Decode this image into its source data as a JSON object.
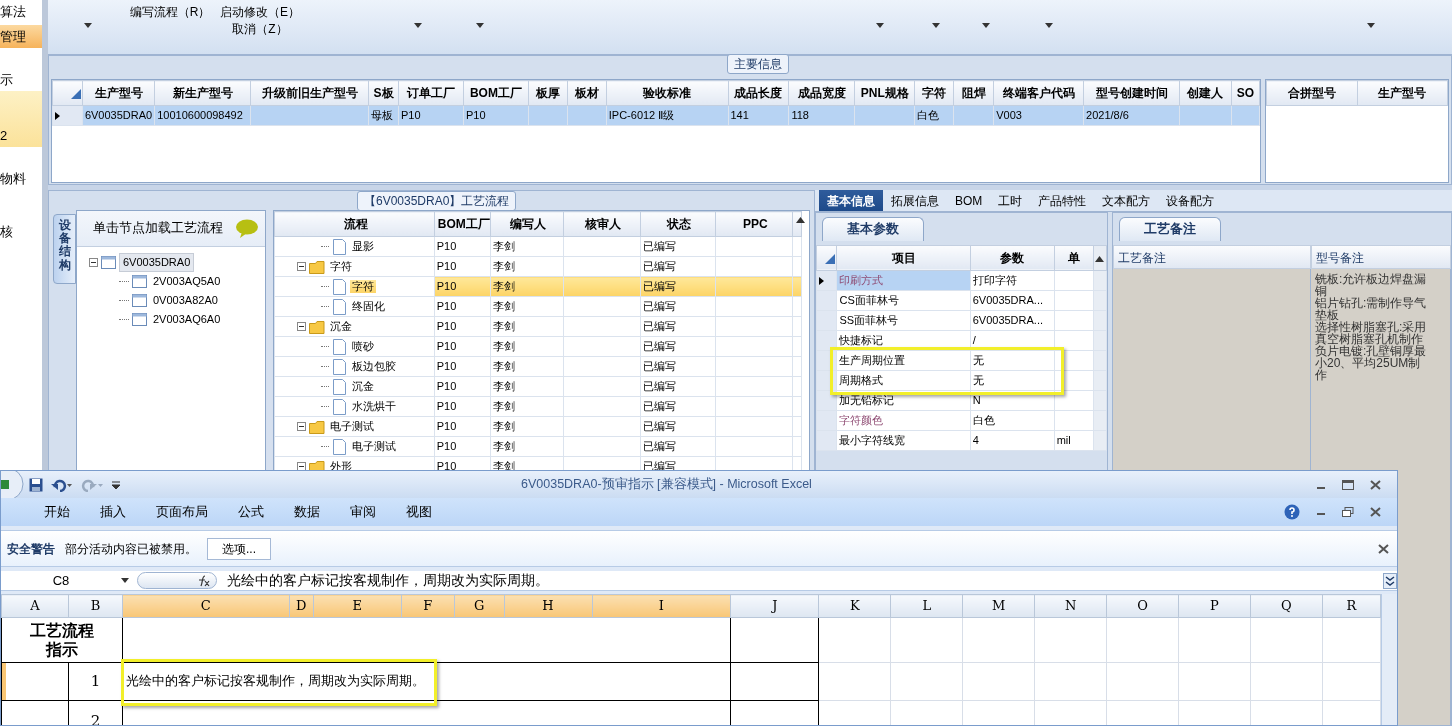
{
  "sidebar": {
    "items": [
      {
        "label": "算法",
        "selected": false,
        "hovered": false
      },
      {
        "label": "管理",
        "selected": true,
        "hovered": false
      },
      {
        "label": "示",
        "selected": false,
        "hovered": false
      },
      {
        "label": "2",
        "selected": false,
        "hovered": true
      },
      {
        "label": "物料",
        "selected": false,
        "hovered": false
      },
      {
        "label": "核",
        "selected": false,
        "hovered": false
      }
    ]
  },
  "toolbar": {
    "groups": [
      {
        "dropdown": true
      },
      {
        "labels": [
          "编写流程（R）"
        ],
        "dropdown": false
      },
      {
        "labels": [
          "启动修改（E）",
          "取消（Z）"
        ],
        "dropdown": false
      },
      {
        "dropdown": true
      },
      {
        "dropdown": true
      },
      {
        "dropdown": true
      },
      {
        "dropdown": true
      },
      {
        "dropdown": true
      },
      {
        "dropdown": true
      },
      {
        "dropdown": true
      }
    ]
  },
  "main_info": {
    "title": "主要信息",
    "columns": [
      "生产型号",
      "新生产型号",
      "升级前旧生产型号",
      "S板",
      "订单工厂",
      "BOM工厂",
      "板厚",
      "板材",
      "验收标准",
      "成品长度",
      "成品宽度",
      "PNL规格",
      "字符",
      "阻焊",
      "终端客户代码",
      "型号创建时间",
      "创建人",
      "SO"
    ],
    "rows": [
      {
        "selected": true,
        "cells": [
          "6V0035DRA0",
          "10010600098492",
          null,
          "母板",
          "P10",
          "P10",
          null,
          null,
          "IPC-6012 Ⅱ级",
          "141",
          "118",
          null,
          "白色",
          null,
          "V003",
          "2021/8/6",
          null,
          null
        ]
      }
    ],
    "side_columns": [
      "合拼型号",
      "生产型号"
    ]
  },
  "process": {
    "title": "【6V0035DRA0】工艺流程",
    "side_tab": "设备结构",
    "tree_hint": "单击节点加载工艺流程",
    "tree": [
      {
        "label": "6V0035DRA0",
        "selected": true,
        "expanded": true,
        "children": [
          {
            "label": "2V003AQ5A0",
            "selected": false
          },
          {
            "label": "0V003A82A0",
            "selected": false
          },
          {
            "label": "2V003AQ6A0",
            "selected": false
          }
        ]
      }
    ],
    "columns": [
      "流程",
      "BOM工厂",
      "编写人",
      "核审人",
      "状态",
      "PPC"
    ],
    "steps": [
      {
        "kind": "step",
        "label": "显影",
        "bom": "P10",
        "writer": "李剑",
        "status": "已编写",
        "selected": false
      },
      {
        "kind": "folder",
        "label": "字符",
        "bom": "P10",
        "writer": "李剑",
        "status": "已编写",
        "selected": false,
        "expanded": true,
        "children": [
          {
            "kind": "step",
            "label": "字符",
            "bom": "P10",
            "writer": "李剑",
            "status": "已编写",
            "selected": true
          },
          {
            "kind": "step",
            "label": "终固化",
            "bom": "P10",
            "writer": "李剑",
            "status": "已编写",
            "selected": false
          }
        ]
      },
      {
        "kind": "folder",
        "label": "沉金",
        "bom": "P10",
        "writer": "李剑",
        "status": "已编写",
        "selected": false,
        "expanded": true,
        "children": [
          {
            "kind": "step",
            "label": "喷砂",
            "bom": "P10",
            "writer": "李剑",
            "status": "已编写",
            "selected": false
          },
          {
            "kind": "step",
            "label": "板边包胶",
            "bom": "P10",
            "writer": "李剑",
            "status": "已编写",
            "selected": false
          },
          {
            "kind": "step",
            "label": "沉金",
            "bom": "P10",
            "writer": "李剑",
            "status": "已编写",
            "selected": false
          },
          {
            "kind": "step",
            "label": "水洗烘干",
            "bom": "P10",
            "writer": "李剑",
            "status": "已编写",
            "selected": false
          }
        ]
      },
      {
        "kind": "folder",
        "label": "电子测试",
        "bom": "P10",
        "writer": "李剑",
        "status": "已编写",
        "selected": false,
        "expanded": true,
        "children": [
          {
            "kind": "step",
            "label": "电子测试",
            "bom": "P10",
            "writer": "李剑",
            "status": "已编写",
            "selected": false
          }
        ]
      },
      {
        "kind": "folder",
        "label": "外形",
        "bom": "P10",
        "writer": "李剑",
        "status": "已编写",
        "selected": false,
        "expanded": true
      }
    ]
  },
  "detail": {
    "tabs": [
      {
        "label": "基本信息",
        "selected": true
      },
      {
        "label": "拓展信息",
        "selected": false
      },
      {
        "label": "BOM",
        "selected": false
      },
      {
        "label": "工时",
        "selected": false
      },
      {
        "label": "产品特性",
        "selected": false
      },
      {
        "label": "文本配方",
        "selected": false
      },
      {
        "label": "设备配方",
        "selected": false
      }
    ],
    "sub_tab": "基本参数",
    "columns": [
      "项目",
      "参数",
      "单"
    ],
    "rows": [
      {
        "item": "印刷方式",
        "value": "打印字符",
        "emphasized": true,
        "selected": true,
        "annotated": false
      },
      {
        "item": "CS面菲林号",
        "value": "6V0035DRA...",
        "emphasized": false,
        "selected": false,
        "annotated": false
      },
      {
        "item": "SS面菲林号",
        "value": "6V0035DRA...",
        "emphasized": false,
        "selected": false,
        "annotated": false
      },
      {
        "item": "快捷标记",
        "value": "/",
        "emphasized": false,
        "selected": false,
        "annotated": false
      },
      {
        "item": "生产周期位置",
        "value": "无",
        "emphasized": false,
        "selected": false,
        "annotated": true
      },
      {
        "item": "周期格式",
        "value": "无",
        "emphasized": false,
        "selected": false,
        "annotated": true
      },
      {
        "item": "加无铅标记",
        "value": "N",
        "emphasized": false,
        "selected": false,
        "annotated": false
      },
      {
        "item": "字符颜色",
        "value": "白色",
        "emphasized": true,
        "selected": false,
        "annotated": false
      },
      {
        "item": "最小字符线宽",
        "value": "4",
        "unit": "mil",
        "emphasized": false,
        "selected": false,
        "annotated": false
      }
    ],
    "notes_tab": "工艺备注",
    "notes_columns": [
      "工艺备注",
      "型号备注"
    ],
    "notes": [
      "铣板:允许板边焊盘漏铜",
      "铝片钻孔:需制作导气垫板",
      "选择性树脂塞孔:采用真空树脂塞孔机制作",
      "负片电镀:孔壁铜厚最小20、平均25UM制作"
    ]
  },
  "excel": {
    "title": "6V0035DRA0-预审指示  [兼容模式] - Microsoft Excel",
    "tabs": [
      "开始",
      "插入",
      "页面布局",
      "公式",
      "数据",
      "审阅",
      "视图"
    ],
    "security": {
      "label": "安全警告",
      "message": "部分活动内容已被禁用。",
      "button": "选项..."
    },
    "name_box": "C8",
    "formula": "光绘中的客户标记按客规制作，周期改为实际周期。",
    "columns": [
      {
        "label": "A",
        "selected": false
      },
      {
        "label": "B",
        "selected": false
      },
      {
        "label": "C",
        "selected": true
      },
      {
        "label": "D",
        "selected": true
      },
      {
        "label": "E",
        "selected": true
      },
      {
        "label": "F",
        "selected": true
      },
      {
        "label": "G",
        "selected": true
      },
      {
        "label": "H",
        "selected": true
      },
      {
        "label": "I",
        "selected": true
      },
      {
        "label": "J",
        "selected": false
      },
      {
        "label": "K",
        "selected": false
      },
      {
        "label": "L",
        "selected": false
      },
      {
        "label": "M",
        "selected": false
      },
      {
        "label": "N",
        "selected": false
      },
      {
        "label": "O",
        "selected": false
      },
      {
        "label": "P",
        "selected": false
      },
      {
        "label": "Q",
        "selected": false
      },
      {
        "label": "R",
        "selected": false
      }
    ],
    "header_lines": [
      "工艺流程",
      "指示"
    ],
    "rows": [
      {
        "number": "1",
        "text": "光绘中的客户标记按客规制作，周期改为实际周期。",
        "selected": true,
        "annotated": true
      },
      {
        "number": "2",
        "selected": false,
        "annotated": false
      }
    ]
  }
}
